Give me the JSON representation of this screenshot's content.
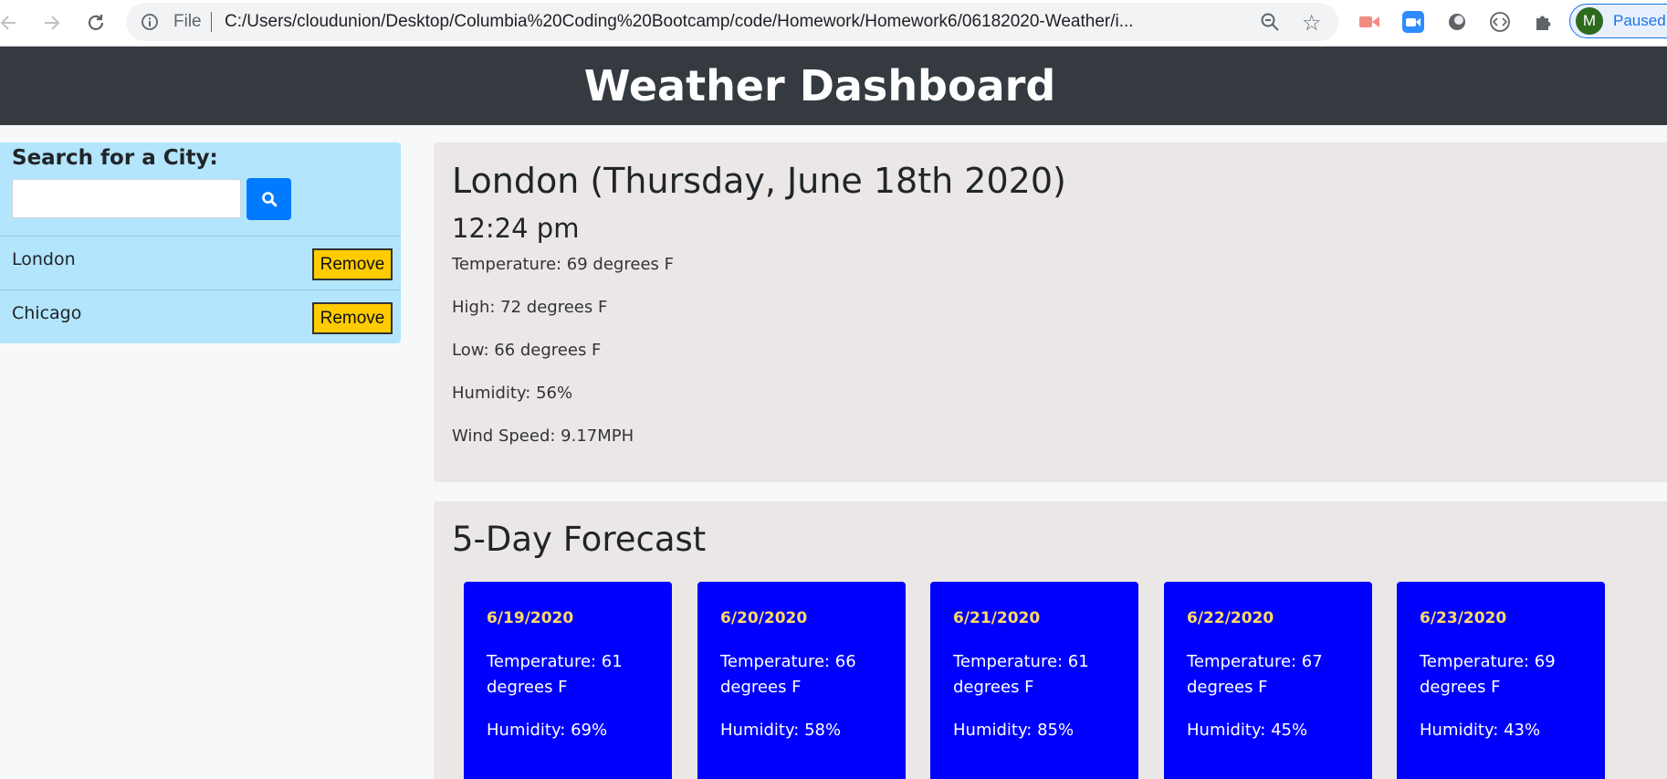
{
  "browser": {
    "file_label": "File",
    "url": "C:/Users/cloudunion/Desktop/Columbia%20Coding%20Bootcamp/code/Homework/Homework6/06182020-Weather/i...",
    "profile_initial": "M",
    "profile_status": "Paused"
  },
  "header": {
    "title": "Weather Dashboard"
  },
  "sidebar": {
    "search_label": "Search for a City:",
    "search_value": "",
    "cities": [
      {
        "name": "London",
        "remove_label": "Remove"
      },
      {
        "name": "Chicago",
        "remove_label": "Remove"
      }
    ]
  },
  "current": {
    "title": "London (Thursday, June 18th 2020)",
    "time": "12:24 pm",
    "temperature": "Temperature: 69 degrees F",
    "high": "High: 72 degrees F",
    "low": "Low: 66 degrees F",
    "humidity": "Humidity: 56%",
    "wind": "Wind Speed: 9.17MPH"
  },
  "forecast": {
    "title": "5-Day Forecast",
    "days": [
      {
        "date": "6/19/2020",
        "temperature": "Temperature: 61 degrees F",
        "humidity": "Humidity: 69%"
      },
      {
        "date": "6/20/2020",
        "temperature": "Temperature: 66 degrees F",
        "humidity": "Humidity: 58%"
      },
      {
        "date": "6/21/2020",
        "temperature": "Temperature: 61 degrees F",
        "humidity": "Humidity: 85%"
      },
      {
        "date": "6/22/2020",
        "temperature": "Temperature: 67 degrees F",
        "humidity": "Humidity: 45%"
      },
      {
        "date": "6/23/2020",
        "temperature": "Temperature: 69 degrees F",
        "humidity": "Humidity: 43%"
      }
    ]
  },
  "colors": {
    "header_bg": "#343a40",
    "sidebar_bg": "#b3e5fc",
    "search_button": "#007bff",
    "remove_button": "#ffcc00",
    "panel_bg": "#ebe7e7",
    "card_bg": "#0000ff",
    "card_date": "#ffd966"
  }
}
